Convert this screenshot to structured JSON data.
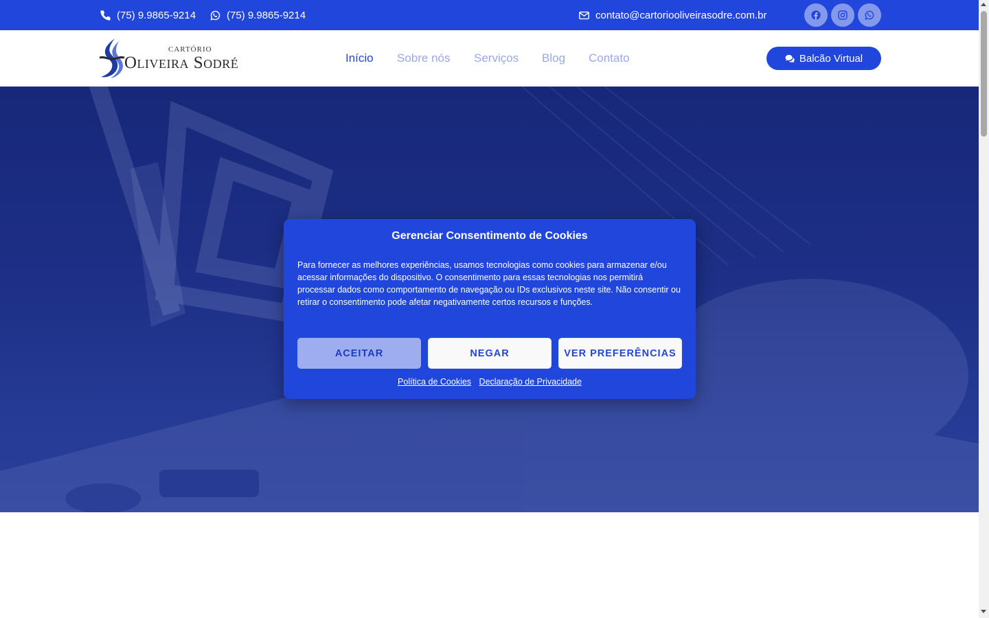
{
  "topbar": {
    "phone": "(75) 9.9865-9214",
    "whatsapp": "(75) 9.9865-9214",
    "email": "contato@cartoriooliveirasodre.com.br",
    "social": [
      "facebook-icon",
      "instagram-icon",
      "whatsapp-icon"
    ]
  },
  "header": {
    "logo_small": "CARTÓRIO",
    "logo_big": "Oliveira Sodré",
    "nav": [
      "Início",
      "Sobre nós",
      "Serviços",
      "Blog",
      "Contato"
    ],
    "cta_label": "Balcão Virtual"
  },
  "cookie": {
    "title": "Gerenciar Consentimento de Cookies",
    "body": "Para fornecer as melhores experiências, usamos tecnologias como cookies para armazenar e/ou acessar informações do dispositivo. O consentimento para essas tecnologias nos permitirá processar dados como comportamento de navegação ou IDs exclusivos neste site. Não consentir ou retirar o consentimento pode afetar negativamente certos recursos e funções.",
    "accept": "ACEITAR",
    "deny": "NEGAR",
    "preferences": "VER PREFERÊNCIAS",
    "cookie_policy": "Política de Cookies",
    "privacy": "Declaração de Privacidade"
  },
  "colors": {
    "brand": "#2146dc",
    "nav_inactive": "#9aa8e6",
    "accept_button": "#9eadf0"
  }
}
